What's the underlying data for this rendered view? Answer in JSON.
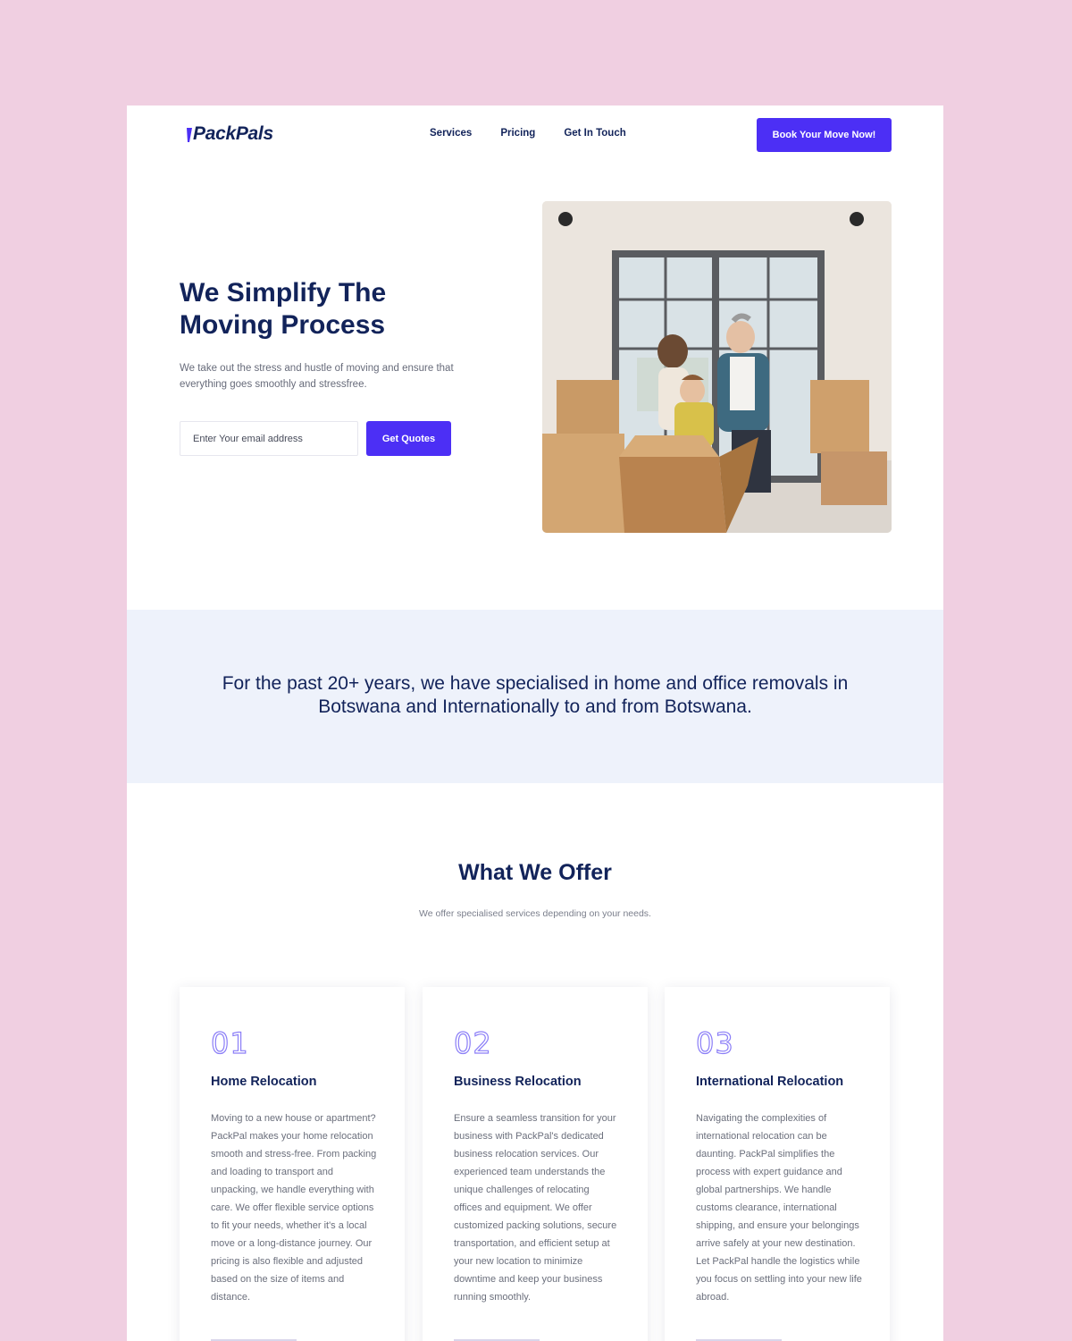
{
  "brand": {
    "name": "PackPals",
    "accent": "#4c2ff5",
    "navy": "#12235a"
  },
  "nav": {
    "links": [
      "Services",
      "Pricing",
      "Get In Touch"
    ],
    "cta": "Book Your Move Now!"
  },
  "hero": {
    "title": "We Simplify The Moving Process",
    "subtitle": "We take out the stress and hustle of moving and ensure that everything goes smoothly and stressfree.",
    "email_placeholder": "Enter Your email address",
    "button": "Get Quotes",
    "image": "family-moving-boxes-photo"
  },
  "band": {
    "text": "For the past 20+ years, we have specialised in home and office removals in Botswana and Internationally to and from Botswana."
  },
  "offer": {
    "title": "What We Offer",
    "subtitle": "We offer specialised services depending on your needs.",
    "cards": [
      {
        "num": "01",
        "title": "Home Relocation",
        "body": "Moving to a new house or apartment? PackPal makes your home relocation smooth and stress-free. From packing and loading to transport and unpacking, we handle everything with care. We offer flexible service options to fit your needs, whether it's a local move or a long-distance journey. Our pricing is also flexible and adjusted based on the size of items and distance."
      },
      {
        "num": "02",
        "title": "Business Relocation",
        "body": "Ensure a seamless transition for your business with PackPal's dedicated business relocation services. Our experienced team understands the unique challenges of relocating offices and equipment. We offer customized packing solutions, secure transportation, and efficient setup at your new location to minimize downtime and keep your business running smoothly."
      },
      {
        "num": "03",
        "title": "International Relocation",
        "body": "Navigating the complexities of international relocation can be daunting. PackPal simplifies the process with expert guidance and global partnerships. We handle customs clearance, international shipping, and ensure your belongings arrive safely at your new destination. Let PackPal handle the logistics while you focus on settling into your new life abroad."
      }
    ]
  }
}
